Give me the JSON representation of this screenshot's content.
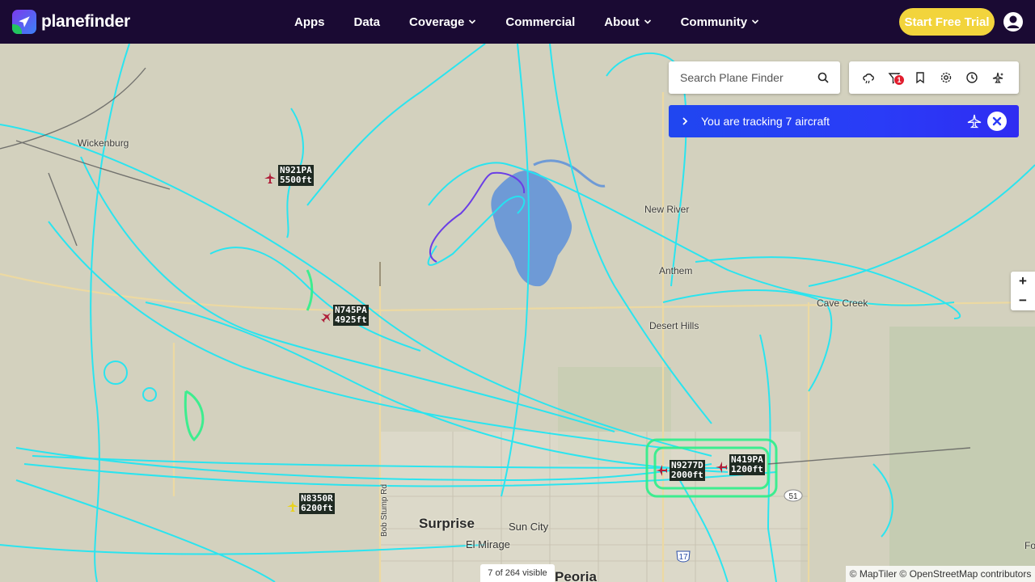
{
  "brand": {
    "name": "planefinder"
  },
  "nav": {
    "items": [
      {
        "label": "Apps",
        "dropdown": false
      },
      {
        "label": "Data",
        "dropdown": false
      },
      {
        "label": "Coverage",
        "dropdown": true
      },
      {
        "label": "Commercial",
        "dropdown": false
      },
      {
        "label": "About",
        "dropdown": true
      },
      {
        "label": "Community",
        "dropdown": true
      }
    ],
    "cta_label": "Start Free Trial"
  },
  "search": {
    "placeholder": "Search Plane Finder"
  },
  "toolbar": {
    "buttons": [
      "weather-icon",
      "filter-icon",
      "bookmark-icon",
      "settings-icon",
      "history-icon",
      "flight-sparkle-icon"
    ],
    "filter_badge": "1"
  },
  "tracking": {
    "text": "You are tracking 7 aircraft"
  },
  "zoom": {
    "in_label": "+",
    "out_label": "−"
  },
  "places": [
    {
      "name": "Wickenburg",
      "cls": ""
    },
    {
      "name": "New River",
      "cls": ""
    },
    {
      "name": "Anthem",
      "cls": ""
    },
    {
      "name": "Cave Creek",
      "cls": ""
    },
    {
      "name": "Desert Hills",
      "cls": ""
    },
    {
      "name": "Surprise",
      "cls": "big"
    },
    {
      "name": "Sun City",
      "cls": "mid"
    },
    {
      "name": "El Mirage",
      "cls": "mid"
    },
    {
      "name": "Peoria",
      "cls": "big"
    },
    {
      "name": "Bob Stump Rd",
      "cls": ""
    },
    {
      "name": "Fo",
      "cls": ""
    }
  ],
  "aircraft": [
    {
      "callsign": "N921PA",
      "altitude": "5500ft",
      "color": "#b0203a"
    },
    {
      "callsign": "N745PA",
      "altitude": "4925ft",
      "color": "#b0203a"
    },
    {
      "callsign": "N9277D",
      "altitude": "2000ft",
      "color": "#b0203a"
    },
    {
      "callsign": "N419PA",
      "altitude": "1200ft",
      "color": "#b0203a"
    },
    {
      "callsign": "N8350R",
      "altitude": "6200ft",
      "color": "#e8d21e"
    }
  ],
  "route_shields": [
    "51",
    "17"
  ],
  "footer": {
    "visible_count": "7 of 264 visible",
    "attribution": "© MapTiler © OpenStreetMap contributors"
  },
  "colors": {
    "nav_bg": "#1a0a33",
    "cta": "#f2d43c",
    "tracking_banner": "#2a3cf7",
    "track_primary": "#22e6f2",
    "track_low": "#2cf08a",
    "lake": "#6e9ad6"
  }
}
